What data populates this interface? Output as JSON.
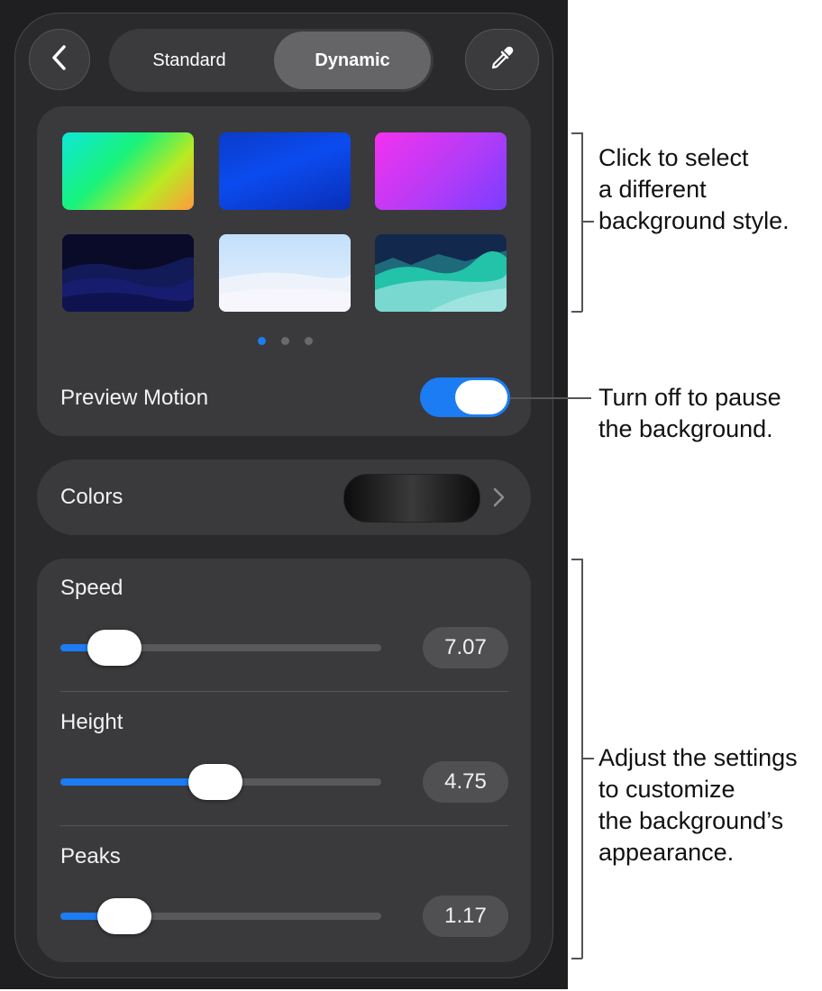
{
  "segmented": {
    "options": [
      "Standard",
      "Dynamic"
    ],
    "selected": "Dynamic"
  },
  "buttons": {
    "back_icon": "chevron-left-icon",
    "eyedropper_icon": "eyedropper-icon"
  },
  "styles": {
    "thumbnails": [
      "rainbow-gradient",
      "blue-gradient",
      "magenta-purple-gradient",
      "dark-navy-waves",
      "light-sky-waves",
      "teal-mountain-waves"
    ],
    "page_count": 3,
    "current_page": 1
  },
  "preview_motion": {
    "label": "Preview Motion",
    "on": true
  },
  "colors": {
    "label": "Colors",
    "chevron_icon": "chevron-right-icon"
  },
  "sliders": {
    "speed": {
      "label": "Speed",
      "value": "7.07",
      "fraction": 0.1
    },
    "height": {
      "label": "Height",
      "value": "4.75",
      "fraction": 0.48
    },
    "peaks": {
      "label": "Peaks",
      "value": "1.17",
      "fraction": 0.14
    }
  },
  "callouts": {
    "style_lines": [
      "Click to select",
      "a different",
      "background style."
    ],
    "motion_lines": [
      "Turn off to pause",
      "the background."
    ],
    "adjust_lines": [
      "Adjust the settings",
      "to customize",
      "the background’s",
      "appearance."
    ]
  },
  "colors_palette": {
    "accent": "#1b7cf4",
    "panel": "#2a2a2c",
    "card": "#3a3a3c"
  }
}
